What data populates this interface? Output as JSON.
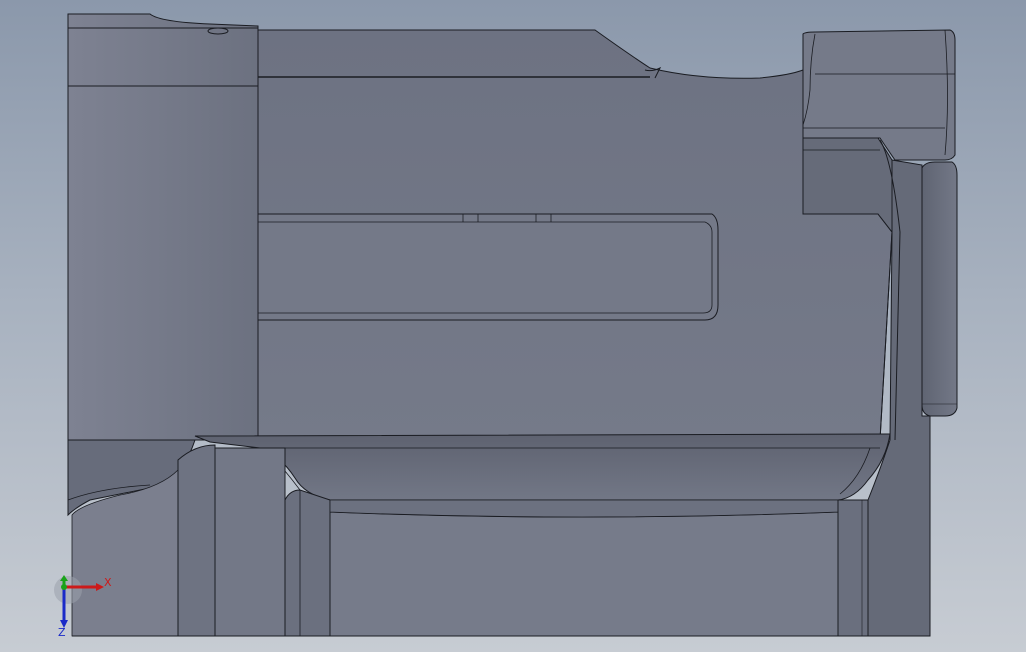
{
  "viewport": {
    "background_top": "#8b98ab",
    "background_bottom": "#c7ccd3",
    "model_color": "#6f7585",
    "edge_color": "#1a1c22"
  },
  "triad": {
    "x_label": "X",
    "z_label": "Z",
    "x_color": "#cc1a1a",
    "y_color": "#1aa31a",
    "z_color": "#1a2ac8"
  }
}
